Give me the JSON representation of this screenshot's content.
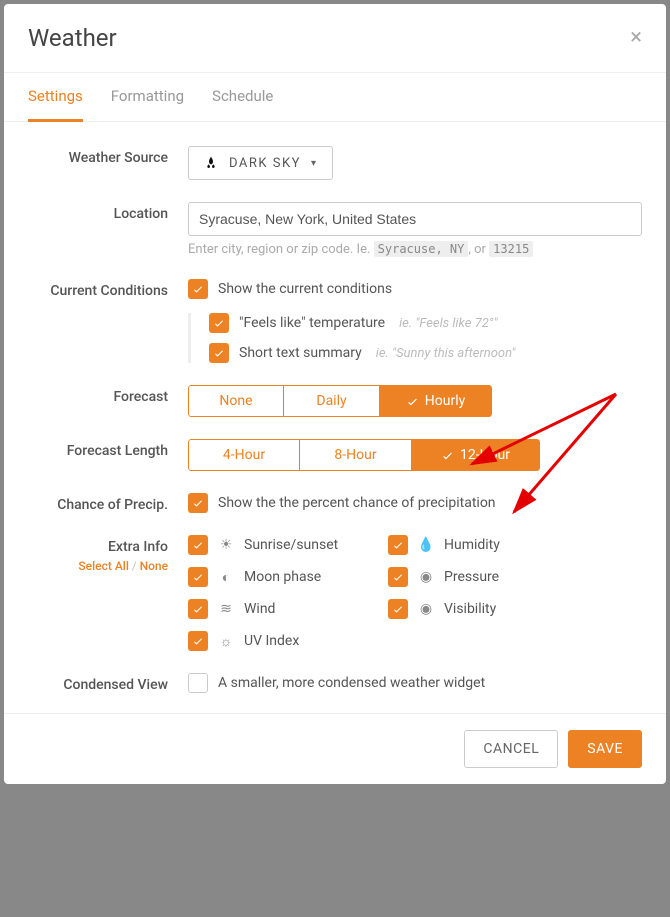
{
  "modal": {
    "title": "Weather"
  },
  "tabs": {
    "settings": "Settings",
    "formatting": "Formatting",
    "schedule": "Schedule"
  },
  "labels": {
    "weather_source": "Weather Source",
    "location": "Location",
    "current_conditions": "Current Conditions",
    "forecast": "Forecast",
    "forecast_length": "Forecast Length",
    "chance_precip": "Chance of Precip.",
    "extra_info": "Extra Info",
    "condensed_view": "Condensed View"
  },
  "sublinks": {
    "select_all": "Select All",
    "none": "None"
  },
  "source": {
    "selected": "DARK SKY"
  },
  "location": {
    "value": "Syracuse, New York, United States",
    "helper_pre": "Enter city, region or zip code. Ie. ",
    "helper_code1": "Syracuse, NY",
    "helper_mid": ", or ",
    "helper_code2": "13215"
  },
  "current": {
    "show_label": "Show the current conditions",
    "feels_label": "\"Feels like\" temperature",
    "feels_hint": "ie. \"Feels like 72°\"",
    "summary_label": "Short text summary",
    "summary_hint": "ie. \"Sunny this afternoon\""
  },
  "forecast": {
    "none": "None",
    "daily": "Daily",
    "hourly": "Hourly"
  },
  "forecast_length": {
    "h4": "4-Hour",
    "h8": "8-Hour",
    "h12": "12-Hour"
  },
  "precip": {
    "label": "Show the the percent chance of precipitation"
  },
  "extras": {
    "sunrise": "Sunrise/sunset",
    "moon": "Moon phase",
    "wind": "Wind",
    "uv": "UV Index",
    "humidity": "Humidity",
    "pressure": "Pressure",
    "visibility": "Visibility"
  },
  "condensed": {
    "label": "A smaller, more condensed weather widget"
  },
  "footer": {
    "cancel": "CANCEL",
    "save": "SAVE"
  }
}
